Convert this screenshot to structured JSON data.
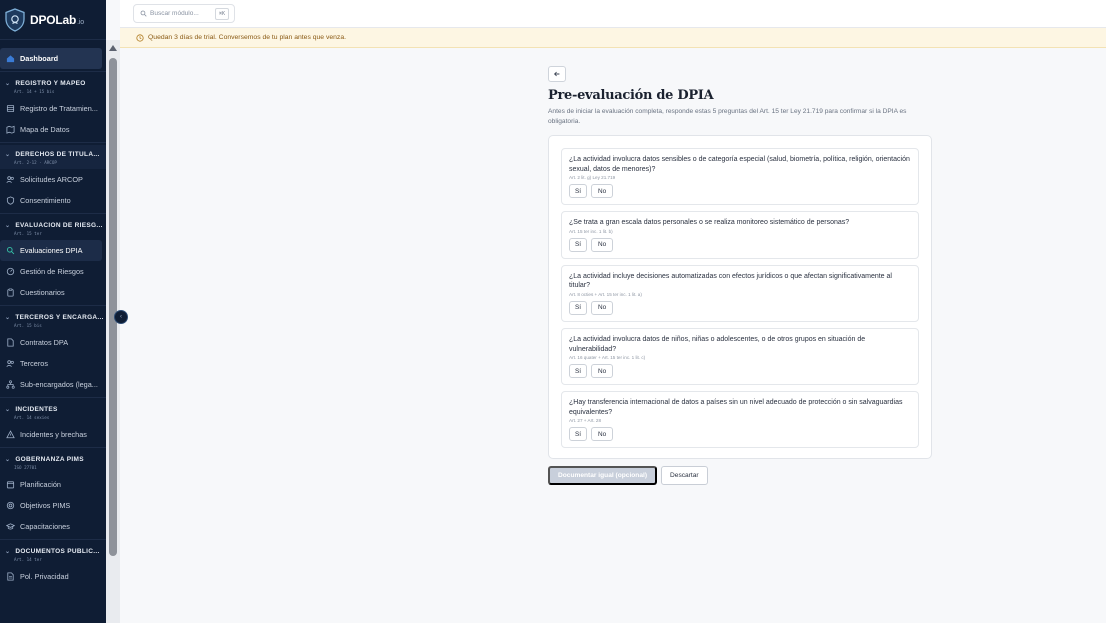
{
  "brand": {
    "name": "DPOLab",
    "suffix": ".io"
  },
  "search": {
    "placeholder": "Buscar módulo...",
    "shortcut": "⌘K"
  },
  "banner": {
    "text": "Quedan 3 días de trial. Conversemos de tu plan antes que venza.",
    "icon": "clock-icon"
  },
  "sidebar": {
    "dashboard": "Dashboard",
    "sections": [
      {
        "title": "REGISTRO Y MAPEO",
        "sub": "Art. 14 + 15 bis",
        "items": [
          "Registro de Tratamien...",
          "Mapa de Datos"
        ]
      },
      {
        "title": "DERECHOS DE TITULA...",
        "sub": "Art. 2-12 · ARCOP",
        "items": [
          "Solicitudes ARCOP",
          "Consentimiento"
        ]
      },
      {
        "title": "EVALUACIÓN DE RIESG...",
        "sub": "Art. 15 ter",
        "items": [
          "Evaluaciones DPIA",
          "Gestión de Riesgos",
          "Cuestionarios"
        ]
      },
      {
        "title": "TERCEROS Y ENCARGA...",
        "sub": "Art. 15 bis",
        "items": [
          "Contratos DPA",
          "Terceros",
          "Sub-encargados (lega..."
        ]
      },
      {
        "title": "INCIDENTES",
        "sub": "Art. 14 sexies",
        "items": [
          "Incidentes y brechas"
        ]
      },
      {
        "title": "GOBERNANZA PIMS",
        "sub": "ISO 27701",
        "items": [
          "Planificación",
          "Objetivos PIMS",
          "Capacitaciones"
        ]
      },
      {
        "title": "DOCUMENTOS PÚBLIC...",
        "sub": "Art. 14 ter",
        "items": [
          "Pol. Privacidad"
        ]
      }
    ]
  },
  "main": {
    "title": "Pre-evaluación de DPIA",
    "subtitle": "Antes de iniciar la evaluación completa, responde estas 5 preguntas del Art. 15 ter Ley 21.719 para confirmar si la DPIA es obligatoria.",
    "yes_label": "Sí",
    "no_label": "No",
    "questions": [
      {
        "text": "¿La actividad involucra datos sensibles o de categoría especial (salud, biometría, política, religión, orientación sexual, datos de menores)?",
        "ref": "Art. 2 lit. g) Ley 21.719"
      },
      {
        "text": "¿Se trata a gran escala datos personales o se realiza monitoreo sistemático de personas?",
        "ref": "Art. 15 ter inc. 1 lit. b)"
      },
      {
        "text": "¿La actividad incluye decisiones automatizadas con efectos jurídicos o que afectan significativamente al titular?",
        "ref": "Art. 8 octies + Art. 15 ter inc. 1 lit. a)"
      },
      {
        "text": "¿La actividad involucra datos de niños, niñas o adolescentes, o de otros grupos en situación de vulnerabilidad?",
        "ref": "Art. 16 quater + Art. 15 ter inc. 1 lit. c)"
      },
      {
        "text": "¿Hay transferencia internacional de datos a países sin un nivel adecuado de protección o sin salvaguardias equivalentes?",
        "ref": "Art. 27 + Art. 28"
      }
    ],
    "primary_label": "Documentar igual (opcional)",
    "discard_label": "Descartar"
  }
}
